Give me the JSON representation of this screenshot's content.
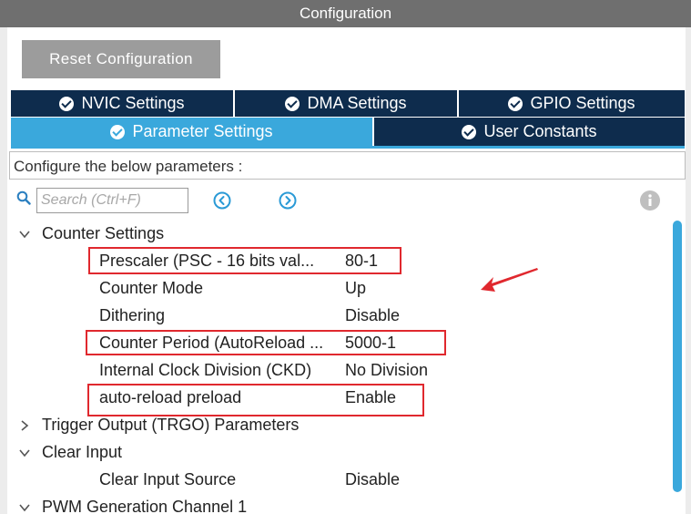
{
  "window": {
    "title": "Configuration"
  },
  "toolbar": {
    "reset_label": "Reset Configuration"
  },
  "tabs_row1": [
    {
      "label": "NVIC Settings",
      "icon": "check-circle-icon"
    },
    {
      "label": "DMA Settings",
      "icon": "check-circle-icon"
    },
    {
      "label": "GPIO Settings",
      "icon": "check-circle-icon"
    }
  ],
  "tabs_row2": [
    {
      "label": "Parameter Settings",
      "icon": "check-circle-icon",
      "active": true
    },
    {
      "label": "User Constants",
      "icon": "check-circle-icon"
    }
  ],
  "configure_text": "Configure the below parameters :",
  "search": {
    "placeholder": "Search (Ctrl+F)"
  },
  "tree": {
    "counter_settings": {
      "label": "Counter Settings",
      "expanded": true,
      "items": [
        {
          "label": "Prescaler (PSC - 16 bits val...",
          "value": "80-1",
          "highlighted": true
        },
        {
          "label": "Counter Mode",
          "value": "Up"
        },
        {
          "label": "Dithering",
          "value": "Disable"
        },
        {
          "label": "Counter Period (AutoReload ...",
          "value": "5000-1",
          "highlighted": true
        },
        {
          "label": "Internal Clock Division (CKD)",
          "value": "No Division"
        },
        {
          "label": "auto-reload preload",
          "value": "Enable",
          "highlighted": true
        }
      ]
    },
    "trigger_output": {
      "label": "Trigger Output (TRGO) Parameters",
      "expanded": false
    },
    "clear_input": {
      "label": "Clear Input",
      "expanded": true,
      "items": [
        {
          "label": "Clear Input Source",
          "value": "Disable"
        }
      ]
    },
    "pwm_channel": {
      "label": "PWM Generation Channel 1",
      "expanded": true
    }
  },
  "colors": {
    "title_bar": "#6f6f6f",
    "tab_dark": "#0e2c4d",
    "tab_active": "#3aa8dc",
    "highlight": "#e0282e",
    "button_bg": "#9c9c9c"
  }
}
